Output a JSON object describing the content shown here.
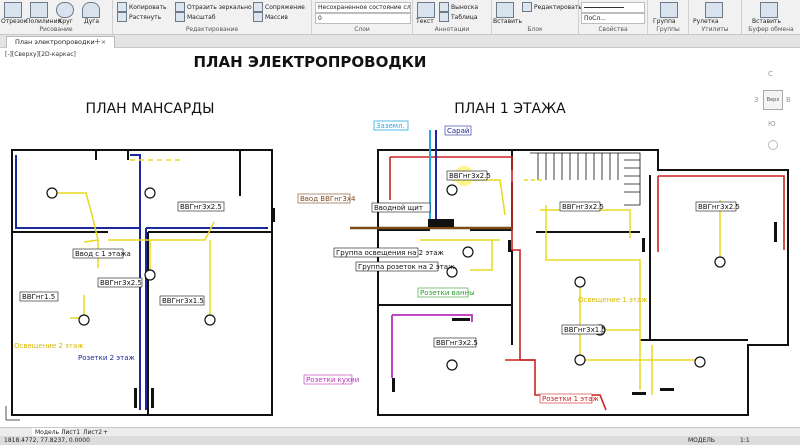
{
  "ribbon": {
    "groups": [
      {
        "title": "Рисование"
      },
      {
        "title": "Редактирование"
      },
      {
        "title": "Слои"
      },
      {
        "title": "Аннотации"
      },
      {
        "title": "Блок"
      },
      {
        "title": "Свойства"
      },
      {
        "title": "Группы"
      },
      {
        "title": "Утилиты"
      },
      {
        "title": "Буфер обмена"
      }
    ],
    "big_tools": {
      "polyline": "Отрезок",
      "polyline2": "Полилиния",
      "circle": "Круг",
      "arc": "Дуга",
      "text": "Текст",
      "insert": "Вставить",
      "group": "Группа",
      "measure": "Рулетка",
      "paste": "Вставить"
    },
    "tools": {
      "copy": "Копировать",
      "mirror": "Отразить зеркально",
      "fillet": "Сопряжение",
      "stretch": "Растянуть",
      "scale": "Масштаб",
      "array": "Массив",
      "layer_state": "Несохраненное состояние слоя",
      "leader": "Выноска",
      "table": "Таблица",
      "edit": "Редактировать",
      "lineweight": "ПоСл..."
    },
    "layer_value": "0",
    "bylayer_value": "ПоСлою"
  },
  "tabs": {
    "doc": "План электропроводки",
    "close": "×",
    "new": "+"
  },
  "view_label": "[-][Сверху][2D-каркас]",
  "drawing": {
    "main_title": "ПЛАН ЭЛЕКТРОПРОВОДКИ",
    "left_title": "ПЛАН МАНСАРДЫ",
    "right_title": "ПЛАН 1 ЭТАЖА",
    "labels": {
      "earth": "Заземл.",
      "sarai": "Сарай",
      "vvod_vvg": "Ввод ВВГнг3х4",
      "vvodnoy": "Вводной щит",
      "cable_top": "ВВГнг3х2.5",
      "group_light2": "Группа освещения на 2 этаж",
      "group_socket2": "Группа розеток на 2 этаж",
      "sockets_bath": "Розетки ванны",
      "cable_r1": "ВВГнг3х2.5",
      "cable_r2": "ВВГнг3х2.5",
      "light_1floor": "Освещение 1 этаж",
      "cable_r3": "ВВГнг3х1.5",
      "cable_kitchen": "ВВГнг3х2.5",
      "sockets_kitchen": "Розетки кухни",
      "sockets_1floor": "Розетки 1 этаж",
      "l_cable1": "ВВГнг3х2.5",
      "l_vvod1": "Ввод с 1 этажа",
      "l_cable2": "ВВГнг3х2.5",
      "l_cable3": "ВВГнг1.5",
      "l_cable4": "ВВГнг3х1.5",
      "l_light2": "Освещение 2 этаж",
      "l_sockets2": "Розетки 2 этаж"
    }
  },
  "layout_tabs": {
    "model": "Модель",
    "sheet1": "Лист1",
    "sheet2": "Лист2",
    "add": "+"
  },
  "status": {
    "coords": "1818.4772, 77.8237, 0.0000",
    "mode": "МОДЕЛЬ",
    "scale": "1:1"
  },
  "navcube": {
    "top": "С",
    "face": "Верх",
    "west": "З",
    "east": "В",
    "south": "Ю"
  }
}
